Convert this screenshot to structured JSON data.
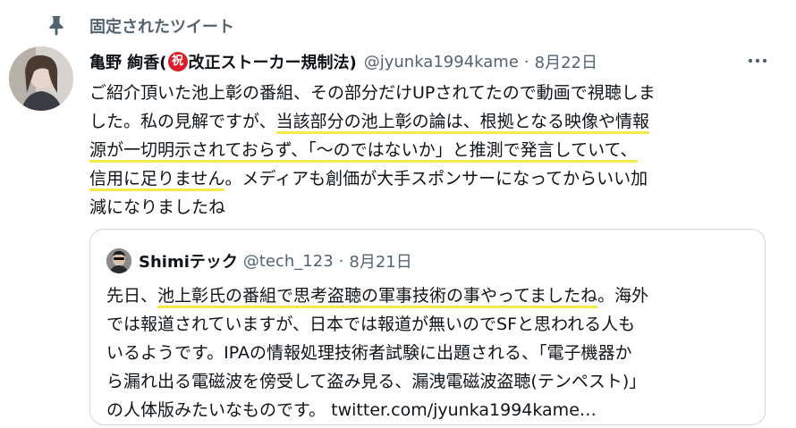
{
  "pinned": {
    "label": "固定されたツイート"
  },
  "author": {
    "name_prefix": "亀野 絢香(",
    "badge": "祝",
    "name_suffix": "改正ストーカー規制法)",
    "handle": "@jyunka1994kame",
    "separator": "·",
    "date": "8月22日"
  },
  "tweet": {
    "line1": "ご紹介頂いた池上彰の番組、その部分だけUPされてたので動画で視聴しま",
    "line2a": "した。私の見解ですが、",
    "line2b": "当該部分の池上彰の論は、根拠となる映像や情報",
    "line3a": "源が一切明示されておらず、「～のではないか」と推測で発言していて、",
    "line4a": "信用に足りません",
    "line4b": "。メディアも創価が大手スポンサーになってからいい加",
    "line5": "減になりましたね"
  },
  "quote": {
    "author": "Shimiテック",
    "handle": "@tech_123",
    "separator": "·",
    "date": "8月21日",
    "line1a": "先日、",
    "line1b": "池上彰氏の番組で思考盗聴の軍事技術の事やってましたね",
    "line1c": "。海外",
    "line2": "では報道されていますが、日本では報道が無いのでSFと思われる人も",
    "line3": "いるようです。IPAの情報処理技術者試験に出題される、「電子機器か",
    "line4": "ら漏れ出る電磁波を傍受して盗み見る、漏洩電磁波盗聴(テンペスト)」",
    "line5a": "の人体版みたいなものです。",
    "link": "twitter.com/jyunka1994kame…"
  },
  "colors": {
    "highlight": "#f4e94a",
    "secondary_text": "#536471",
    "badge": "#d81e2c"
  },
  "icons": {
    "pin": "pin-icon",
    "more": "more-icon"
  }
}
